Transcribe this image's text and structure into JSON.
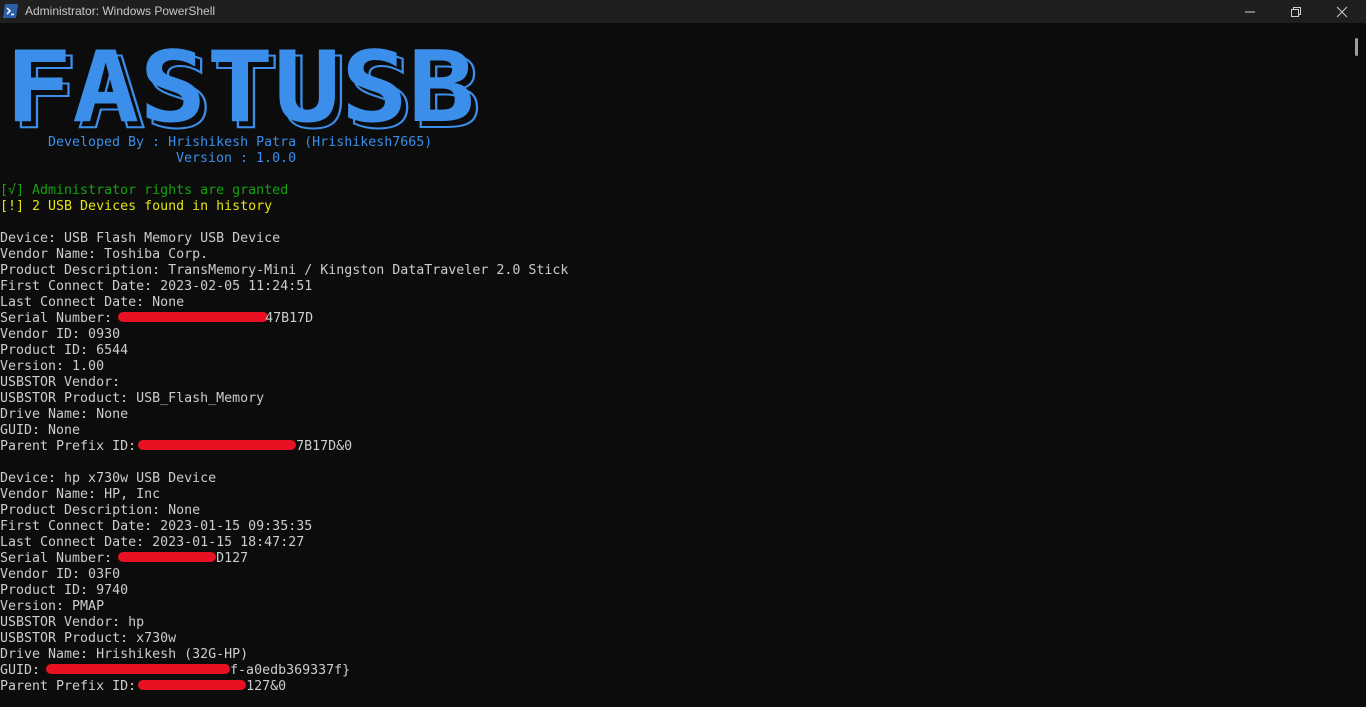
{
  "window": {
    "title": "Administrator: Windows PowerShell",
    "icon": "powershell-icon",
    "controls": [
      "minimize-icon",
      "maximize-icon",
      "close-icon"
    ]
  },
  "banner": {
    "logo_text": "FASTUSB",
    "developed_by": "Developed By : Hrishikesh Patra (Hrishikesh7665)",
    "version": "Version : 1.0.0"
  },
  "status": {
    "admin": "[√] Administrator rights are granted",
    "found": "[!] 2 USB Devices found in history"
  },
  "devices": [
    {
      "device": "Device: USB Flash Memory USB Device",
      "vendor_name": "Vendor Name: Toshiba Corp.",
      "product_description": "Product Description: TransMemory-Mini / Kingston DataTraveler 2.0 Stick",
      "first_connect": "First Connect Date: 2023-02-05 11:24:51",
      "last_connect": "Last Connect Date: None",
      "serial_label": "Serial Number: ",
      "serial_visible": "47B17D",
      "vendor_id": "Vendor ID: 0930",
      "product_id": "Product ID: 6544",
      "version": "Version: 1.00",
      "usbstor_vendor": "USBSTOR Vendor:",
      "usbstor_product": "USBSTOR Product: USB_Flash_Memory",
      "drive_name": "Drive Name: None",
      "guid_label": "GUID: None",
      "guid_visible": "",
      "parent_label": "Parent Prefix ID: ",
      "parent_visible": "7B17D&0"
    },
    {
      "device": "Device: hp x730w USB Device",
      "vendor_name": "Vendor Name: HP, Inc",
      "product_description": "Product Description: None",
      "first_connect": "First Connect Date: 2023-01-15 09:35:35",
      "last_connect": "Last Connect Date: 2023-01-15 18:47:27",
      "serial_label": "Serial Number: ",
      "serial_visible": "D127",
      "vendor_id": "Vendor ID: 03F0",
      "product_id": "Product ID: 9740",
      "version": "Version: PMAP",
      "usbstor_vendor": "USBSTOR Vendor: hp",
      "usbstor_product": "USBSTOR Product: x730w",
      "drive_name": "Drive Name: Hrishikesh (32G-HP)",
      "guid_label": "GUID: ",
      "guid_visible": "f-a0edb369337f}",
      "parent_label": "Parent Prefix ID: ",
      "parent_visible": "127&0"
    }
  ],
  "colors": {
    "background": "#0c0c0c",
    "banner_blue": "#3b8eea",
    "success_green": "#13a10e",
    "warning_yellow": "#e5e510",
    "redaction_red": "#e81123"
  }
}
